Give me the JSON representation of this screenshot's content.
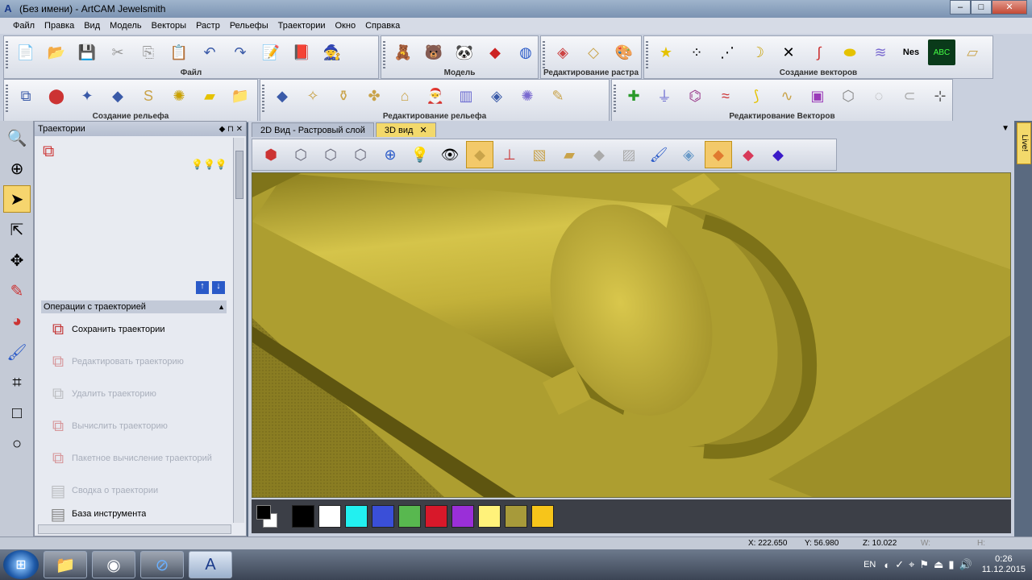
{
  "window": {
    "title": "(Без имени) - ArtCAM Jewelsmith",
    "app_icon": "A",
    "minimize": "–",
    "maximize": "□",
    "close": "✕"
  },
  "menu": [
    "Файл",
    "Правка",
    "Вид",
    "Модель",
    "Векторы",
    "Растр",
    "Рельефы",
    "Траектории",
    "Окно",
    "Справка"
  ],
  "toolbars": {
    "file_caption": "Файл",
    "model_caption": "Модель",
    "raster_caption": "Редактирование растра",
    "vectors_create_caption": "Создание векторов",
    "relief_create_caption": "Создание рельефа",
    "relief_edit_caption": "Редактирование рельефа",
    "vectors_edit_caption": "Редактирование Векторов"
  },
  "panel": {
    "title": "Траектории",
    "pin": "◆ ⊓ ✕",
    "ops_header": "Операции с траекторией",
    "ops_collapse": "▲",
    "operations": [
      {
        "label": "Сохранить траектории",
        "enabled": true
      },
      {
        "label": "Редактировать траекторию",
        "enabled": false
      },
      {
        "label": "Удалить траекторию",
        "enabled": false
      },
      {
        "label": "Вычислить траекторию",
        "enabled": false
      },
      {
        "label": "Пакетное вычисление траекторий",
        "enabled": false
      },
      {
        "label": "Сводка о траектории",
        "enabled": false
      },
      {
        "label": "База инструмента",
        "enabled": true
      }
    ]
  },
  "tabs": {
    "tab_2d": "2D Вид - Растровый слой",
    "tab_3d": "3D вид",
    "tab_3d_close": "✕"
  },
  "side_tab": "Live!",
  "palette": {
    "colors": [
      "#000000",
      "#ffffff",
      "#22f0f0",
      "#3a4fd8",
      "#58b84f",
      "#d8182a",
      "#9a2fd8",
      "#fff27a",
      "#a79a3a",
      "#f7c51a"
    ]
  },
  "status": {
    "x": "X: 222.650",
    "y": "Y: 56.980",
    "z": "Z: 10.022",
    "w": "W:",
    "h": "H:"
  },
  "taskbar": {
    "lang": "EN",
    "time": "0:26",
    "date": "11.12.2015"
  },
  "colors": {
    "relief_gold": "#a99a2b",
    "highlight": "#f3c96a"
  }
}
